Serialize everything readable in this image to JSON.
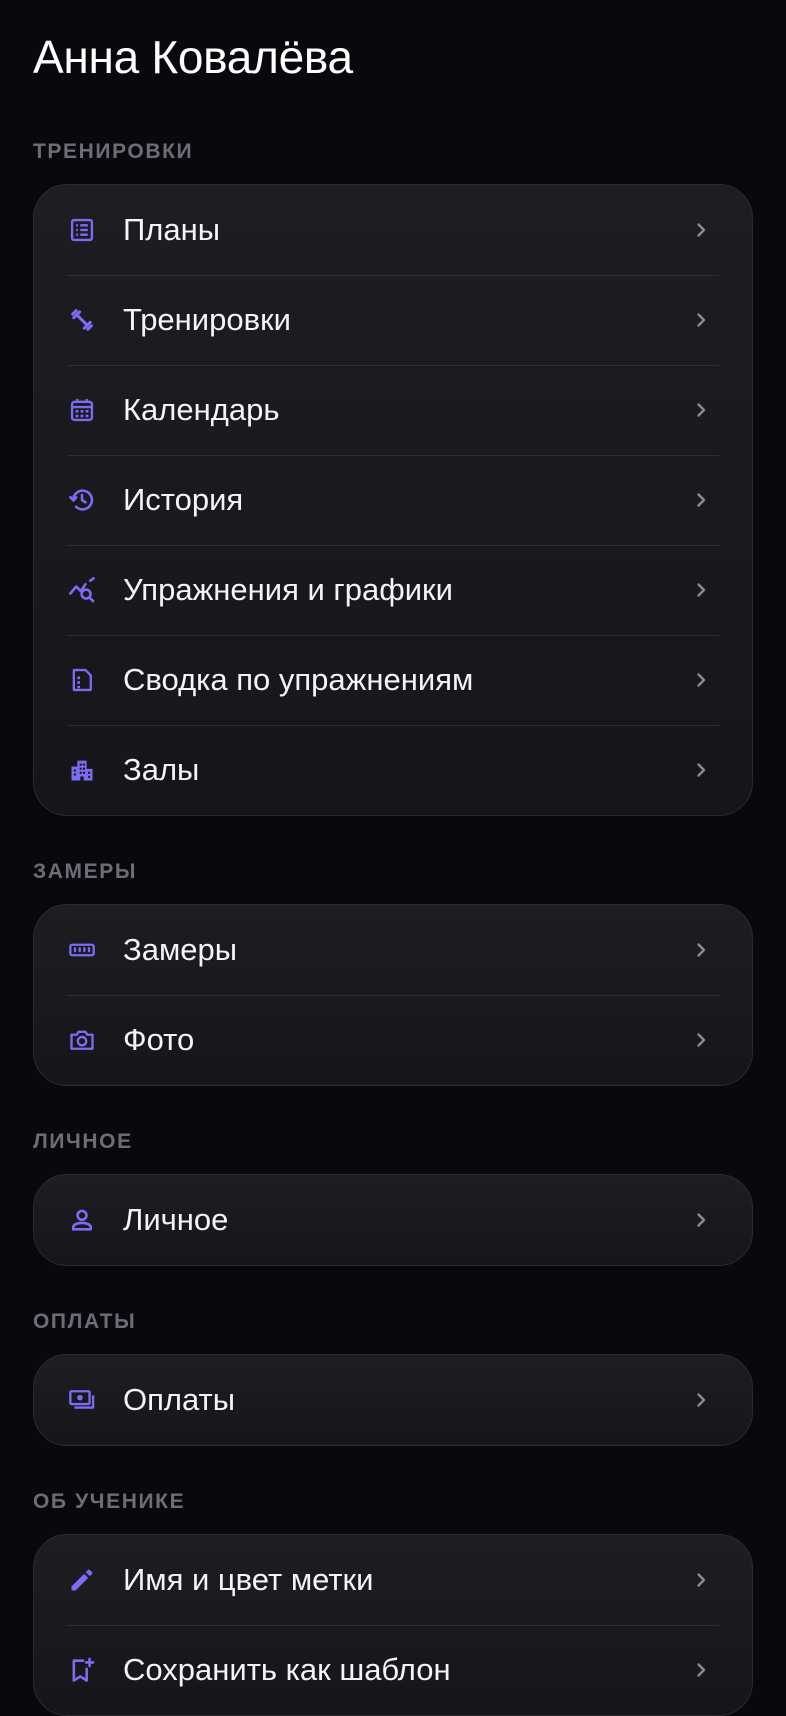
{
  "user": {
    "name": "Анна Ковалёва"
  },
  "accent_color": "#7b6cf6",
  "sections": {
    "training": {
      "title": "ТРЕНИРОВКИ",
      "items": [
        {
          "label": "Планы",
          "icon": "list-icon"
        },
        {
          "label": "Тренировки",
          "icon": "dumbbell-icon"
        },
        {
          "label": "Календарь",
          "icon": "calendar-icon"
        },
        {
          "label": "История",
          "icon": "history-icon"
        },
        {
          "label": "Упражнения и графики",
          "icon": "chart-search-icon"
        },
        {
          "label": "Сводка по упражнениям",
          "icon": "summary-icon"
        },
        {
          "label": "Залы",
          "icon": "building-icon"
        }
      ]
    },
    "measurements": {
      "title": "ЗАМЕРЫ",
      "items": [
        {
          "label": "Замеры",
          "icon": "ruler-icon"
        },
        {
          "label": "Фото",
          "icon": "camera-icon"
        }
      ]
    },
    "personal": {
      "title": "ЛИЧНОЕ",
      "items": [
        {
          "label": "Личное",
          "icon": "person-icon"
        }
      ]
    },
    "payments": {
      "title": "ОПЛАТЫ",
      "items": [
        {
          "label": "Оплаты",
          "icon": "payments-icon"
        }
      ]
    },
    "about": {
      "title": "ОБ УЧЕНИКЕ",
      "items": [
        {
          "label": "Имя и цвет метки",
          "icon": "pencil-icon"
        },
        {
          "label": "Сохранить как шаблон",
          "icon": "bookmark-add-icon"
        }
      ]
    }
  }
}
